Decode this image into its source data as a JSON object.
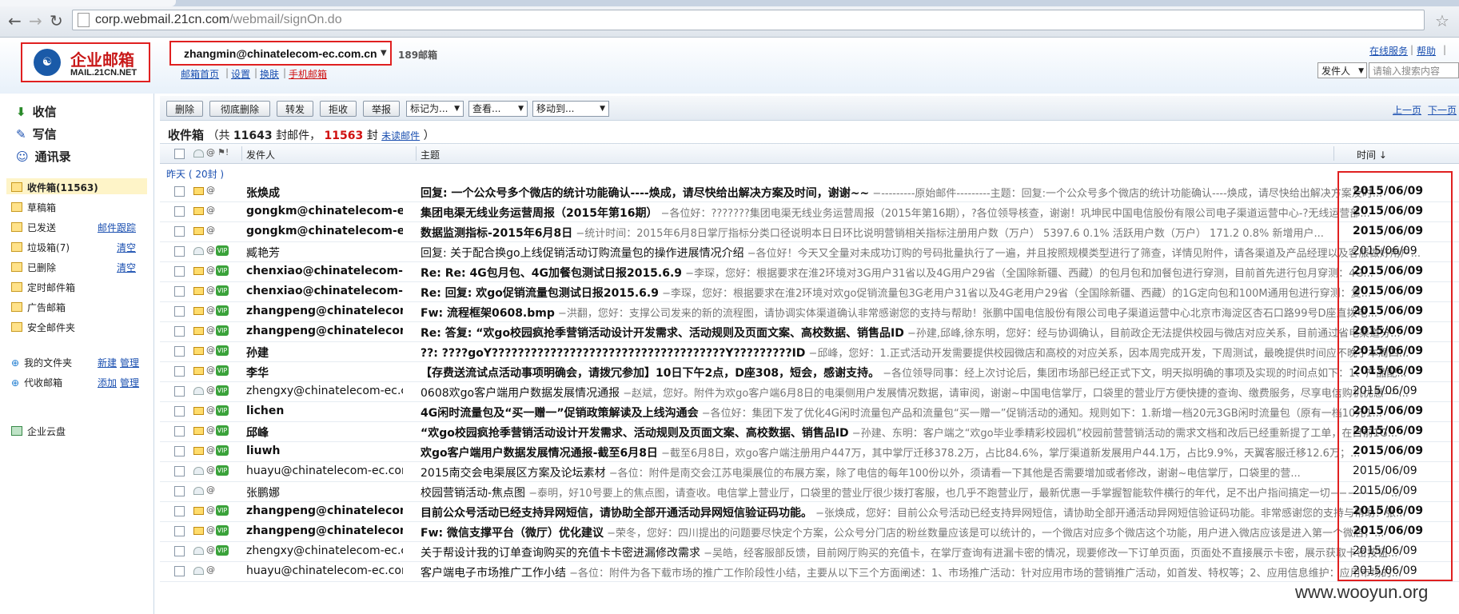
{
  "browser": {
    "url_host": "corp.webmail.21cn.com",
    "url_path": "/webmail/signOn.do",
    "back_glyph": "←",
    "forward_glyph": "→",
    "reload_glyph": "↻",
    "star_glyph": "☆"
  },
  "header": {
    "logo_cn": "企业邮箱",
    "logo_en": "MAIL.21CN.NET",
    "account_email": "zhangmin@chinatelecom-ec.com.cn",
    "brand": "189邮箱",
    "links": [
      "邮箱首页",
      "设置",
      "换肤",
      "手机邮箱"
    ],
    "top_right_links": [
      "在线服务",
      "帮助"
    ],
    "search_select": "发件人",
    "search_placeholder": "请输入搜索内容"
  },
  "sidebar": {
    "primary": [
      "收信",
      "写信",
      "通讯录"
    ],
    "folders": [
      {
        "label": "收件箱",
        "count": "(11563)"
      },
      {
        "label": "草稿箱",
        "count": ""
      },
      {
        "label": "已发送",
        "count": "",
        "action": "邮件跟踪"
      },
      {
        "label": "垃圾箱",
        "count": "(7)",
        "action": "清空"
      },
      {
        "label": "已删除",
        "count": "",
        "action": "清空"
      },
      {
        "label": "定时邮件箱",
        "count": ""
      },
      {
        "label": "广告邮箱",
        "count": ""
      },
      {
        "label": "安全邮件夹",
        "count": ""
      }
    ],
    "my_folders": "我的文件夹",
    "my_folders_actions": [
      "新建",
      "管理"
    ],
    "proxy": "代收邮箱",
    "proxy_actions": [
      "添加",
      "管理"
    ],
    "cloud": "企业云盘"
  },
  "toolbar": {
    "buttons": [
      "删除",
      "彻底删除",
      "转发",
      "拒收",
      "举报"
    ],
    "selects": [
      "标记为...",
      "查看...",
      "移动到..."
    ],
    "pager": [
      "上一页",
      "下一页"
    ]
  },
  "inbox": {
    "title": "收件箱",
    "total_prefix": "（共",
    "total": "11643",
    "total_mid": "封邮件，",
    "unread": "11563",
    "unread_mid": "封",
    "unread_link": "未读邮件",
    "total_suffix": "）",
    "columns": {
      "from": "发件人",
      "subject": "主题",
      "time": "时间 ↓"
    },
    "group_label": "昨天",
    "group_count": "( 20封 )"
  },
  "rows": [
    {
      "from": "张焕成",
      "subject": "回复: 一个公众号多个微店的统计功能确认----焕成，请尽快给出解决方案及时间，谢谢~~",
      "preview": " −---------原始邮件---------主题：回复:一个公众号多个微店的统计功能确认----焕成，请尽快给出解决方案及时...",
      "date": "2015/06/09",
      "unread": true,
      "flag": false
    },
    {
      "from": "gongkm@chinatelecom-ec....",
      "subject": "集团电渠无线业务运营周报（2015年第16期）",
      "preview": " −各位好：???????集团电渠无线业务运营周报（2015年第16期），?各位领导核查，谢谢！巩坤民中国电信股份有限公司电子渠道运营中心-?无线运营部...",
      "date": "2015/06/09",
      "unread": true,
      "flag": false
    },
    {
      "from": "gongkm@chinatelecom-ec....",
      "subject": "数据监测指标-2015年6月8日",
      "preview": " −统计时间：2015年6月8日掌厅指标分类口径说明本日日环比说明营销相关指标注册用户数（万户） 5397.6 0.1% 活跃用户数（万户） 171.2 0.8% 新增用户...",
      "date": "2015/06/09",
      "unread": true,
      "flag": false
    },
    {
      "from": "臧艳芳",
      "subject": "回复: 关于配合换go上线促销活动订购流量包的操作进展情况介绍",
      "preview": " −各位好！今天又全量对未成功订购的号码批量执行了一遍，并且按照规模类型进行了筛查，详情见附件，请各渠道及产品经理以及客服做好用户...",
      "date": "2015/06/09",
      "unread": false,
      "flag": true
    },
    {
      "from": "chenxiao@chinatelecom-ec...",
      "subject": "Re: Re: 4G包月包、4G加餐包测试日报2015.6.9",
      "preview": " −李琛，您好：根据要求在淮2环境对3G用户31省以及4G用户29省（全国除新疆、西藏）的包月包和加餐包进行穿测，目前首先进行包月穿测：4G...",
      "date": "2015/06/09",
      "unread": true,
      "flag": true
    },
    {
      "from": "chenxiao@chinatelecom-ec...",
      "subject": "Re: 回复: 欢go促销流量包测试日报2015.6.9",
      "preview": " −李琛，您好：根据要求在淮2环境对欢go促销流量包3G老用户31省以及4G老用户29省（全国除新疆、西藏）的1G定向包和100M通用包进行穿测：复...",
      "date": "2015/06/09",
      "unread": true,
      "flag": true
    },
    {
      "from": "zhangpeng@chinatelecom-...",
      "subject": "Fw: 流程框架0608.bmp",
      "preview": " −洪翻，您好：支撑公司发来的新的流程图，请协调实体渠道确认非常感谢您的支持与帮助！张鹏中国电信股份有限公司电子渠道运营中心北京市海淀区杏石口路99号D座直拨电...",
      "date": "2015/06/09",
      "unread": true,
      "flag": true
    },
    {
      "from": "zhangpeng@chinatelecom-...",
      "subject": "Re: 答复: “欢go校园疯抢季营销活动设计开发需求、活动规则及页面文案、高校数据、销售品ID",
      "preview": " −孙建,邱峰,徐东明，您好：经与协调确认，目前政企无法提供校园与微店对应关系，目前通过省电渠道分...",
      "date": "2015/06/09",
      "unread": true,
      "flag": true
    },
    {
      "from": "孙建",
      "subject": "??: ????goY????????????????????????????????????Y?????????ID",
      "preview": " −邱峰，您好：1.正式活动开发需要提供校园微店和高校的对应关系，因本周完成开发，下周测试，最晚提供时间应不晚于本周四...",
      "date": "2015/06/09",
      "unread": true,
      "flag": true
    },
    {
      "from": "李华",
      "subject": "【存费送流试点活动事项明确会，请拨冗参加】10日下午2点，D座308，短会，感谢支持。",
      "preview": " −各位领导同事：经上次讨论后，集团市场部已经正式下文，明天拟明确的事项及实现的时间点如下：1、产品配...",
      "date": "2015/06/09",
      "unread": true,
      "flag": true
    },
    {
      "from": "zhengxy@chinatelecom-ec.com...",
      "subject": "0608欢go客户端用户数据发展情况通报",
      "preview": " −赵斌，您好。附件为欢go客户端6月8日的电渠侧用户发展情况数据，请审阅，谢谢~中国电信掌厅，口袋里的营业厅方便快捷的查询、缴费服务，尽享电信购机优惠----...",
      "date": "2015/06/09",
      "unread": false,
      "flag": true
    },
    {
      "from": "lichen",
      "subject": "4G闲时流量包及“买一赠一”促销政策解读及上线沟通会",
      "preview": " −各位好：集团下发了优化4G闲时流量包产品和流量包“买一赠一”促销活动的通知。规则如下：1.新增一档20元3GB闲时流量包（原有一档10元1...",
      "date": "2015/06/09",
      "unread": true,
      "flag": true
    },
    {
      "from": "邱峰",
      "subject": "“欢go校园疯抢季营销活动设计开发需求、活动规则及页面文案、高校数据、销售品ID",
      "preview": " −孙建、东明：客户端之“欢go毕业季精彩校园机”校园前营营销活动的需求文档和改后已经重新提了工单，在目前1G...",
      "date": "2015/06/09",
      "unread": true,
      "flag": true
    },
    {
      "from": "liuwh",
      "subject": "欢go客户端用户数据发展情况通报-截至6月8日",
      "preview": " −截至6月8日，欢go客户端注册用户447万，其中掌厅迁移378.2万，占比84.6%，掌厅渠道新发展用户44.1万，占比9.9%，天翼客服迁移12.6万；...",
      "date": "2015/06/09",
      "unread": true,
      "flag": true
    },
    {
      "from": "huayu@chinatelecom-ec.com...",
      "subject": "2015南交会电渠展区方案及论坛素材",
      "preview": " −各位：附件是南交会江苏电渠展位的布展方案，除了电信的每年100份以外，须请看一下其他是否需要增加或者修改，谢谢~电信掌厅，口袋里的营...",
      "date": "2015/06/09",
      "unread": false,
      "flag": true
    },
    {
      "from": "张鹏娜",
      "subject": "校园营销活动-焦点图",
      "preview": " −泰明，好10号要上的焦点图，请查收。电信掌上营业厅，口袋里的营业厅很少拨打客服，也几乎不跑营业厅，最新优惠一手掌握智能软件横行的年代，足不出户指间搞定一切−−−−−−−...",
      "date": "2015/06/09",
      "unread": false,
      "flag": false
    },
    {
      "from": "zhangpeng@chinatelecom-...",
      "subject": "目前公众号活动已经支持异网短信，请协助全部开通活动异网短信验证码功能。",
      "preview": " −张焕成，您好：目前公众号活动已经支持异网短信，请协助全部开通活动异网短信验证码功能。非常感谢您的支持与帮助！张...",
      "date": "2015/06/09",
      "unread": true,
      "flag": true
    },
    {
      "from": "zhangpeng@chinatelecom-...",
      "subject": "Fw: 微信支撑平台（微厅）优化建议",
      "preview": " −荣冬，您好：四川提出的问题要尽快定个方案，公众号分门店的粉丝数量应该是可以统计的，一个微店对应多个微店这个功能，用户进入微店应该是进入第一个微店，...",
      "date": "2015/06/09",
      "unread": true,
      "flag": true
    },
    {
      "from": "zhengxy@chinatelecom-ec.com...",
      "subject": "关于帮设计我的订单查询购买的充值卡卡密进漏修改需求",
      "preview": " −吴皓，经客服部反馈，目前网厅购买的充值卡，在掌厅查询有进漏卡密的情况，现要修改一下订单页面，页面处不直接展示卡密，展示获取卡密按钮...",
      "date": "2015/06/09",
      "unread": false,
      "flag": true
    },
    {
      "from": "huayu@chinatelecom-ec.com...",
      "subject": "客户端电子市场推广工作小结",
      "preview": " −各位：附件为各下载市场的推广工作阶段性小结，主要从以下三个方面阐述：1、市场推广活动：针对应用市场的营销推广活动，如首发、特权等；2、应用信息维护：应用市场的...",
      "date": "2015/06/09",
      "unread": false,
      "flag": false
    }
  ],
  "watermark": "www.wooyun.org"
}
